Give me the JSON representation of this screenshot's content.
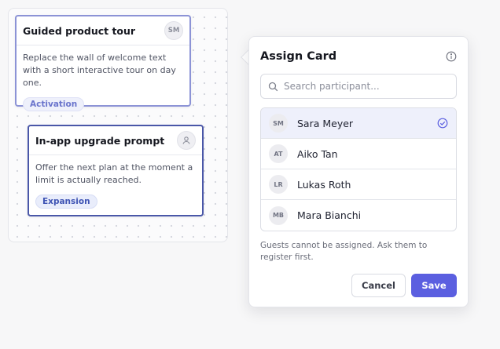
{
  "board": {
    "cards": [
      {
        "title": "Guided product tour",
        "avatar_initials": "SM",
        "description": "Replace the wall of welcome text with a short interactive tour on day one.",
        "tag": "Activation"
      },
      {
        "title": "In-app upgrade prompt",
        "avatar_icon": "user-icon",
        "description": "Offer the next plan at the moment a limit is actually reached.",
        "tag": "Expansion"
      }
    ]
  },
  "popover": {
    "title": "Assign Card",
    "info_icon": "info-icon",
    "search": {
      "placeholder": "Search participant...",
      "value": ""
    },
    "participants": [
      {
        "initials": "SM",
        "name": "Sara Meyer",
        "selected": true
      },
      {
        "initials": "AT",
        "name": "Aiko Tan",
        "selected": false
      },
      {
        "initials": "LR",
        "name": "Lukas Roth",
        "selected": false
      },
      {
        "initials": "MB",
        "name": "Mara Bianchi",
        "selected": false
      }
    ],
    "note": "Guests cannot be assigned. Ask them to register first.",
    "cancel_label": "Cancel",
    "save_label": "Save"
  },
  "colors": {
    "accent": "#5b5fe0",
    "selected_row": "#eef0fb",
    "card_1_border": "#8c93d6",
    "card_2_border": "#4a57a8"
  }
}
